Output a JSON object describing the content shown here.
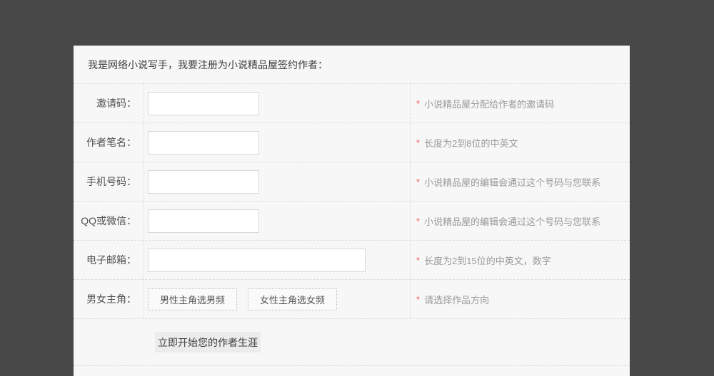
{
  "colors": {
    "page_background": "#474747",
    "panel_background": "#f7f7f7",
    "dashed_border": "#dcdcdc",
    "required_star": "#ee5f5f",
    "hint_text": "#999999"
  },
  "header": {
    "title": "我是网络小说写手，我要注册为小说精品屋签约作者："
  },
  "form": {
    "required_marker": "*",
    "rows": [
      {
        "label": "邀请码：",
        "value": "",
        "hint": "小说精品屋分配给作者的邀请码"
      },
      {
        "label": "作者笔名：",
        "value": "",
        "hint": "长度为2到8位的中英文"
      },
      {
        "label": "手机号码：",
        "value": "",
        "hint": "小说精品屋的编辑会通过这个号码与您联系"
      },
      {
        "label": "QQ或微信：",
        "value": "",
        "hint": "小说精品屋的编辑会通过这个号码与您联系"
      },
      {
        "label": "电子邮箱：",
        "value": "",
        "hint": "长度为2到15位的中英文，数字"
      }
    ],
    "channel_row": {
      "label": "男女主角：",
      "male_button": "男性主角选男频",
      "female_button": "女性主角选女频",
      "hint": "请选择作品方向"
    },
    "submit_button": "立即开始您的作者生涯"
  }
}
